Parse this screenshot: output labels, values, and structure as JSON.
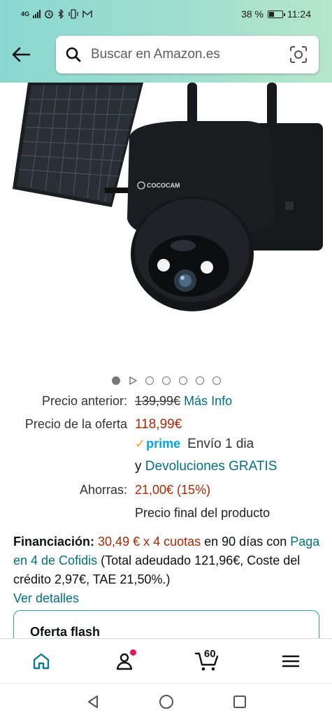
{
  "status_bar": {
    "network": "4G",
    "battery_percent": "38 %",
    "battery_level": 0.38,
    "time": "11:24"
  },
  "header": {
    "search_placeholder": "Buscar en Amazon.es"
  },
  "product": {
    "image_brand_text": "COCOCAM",
    "carousel": {
      "total_images": 7,
      "active_index": 0
    }
  },
  "pricing": {
    "previous_label": "Precio anterior:",
    "previous_price": "139,99€",
    "more_info_link": "Más Info",
    "offer_label": "Precio de la oferta",
    "offer_price": "118,99€",
    "prime_text": "prime",
    "shipping_text": "Envío 1 dia",
    "returns_prefix": "y",
    "returns_link": "Devoluciones GRATIS",
    "savings_label": "Ahorras:",
    "savings_value": "21,00€ (15%)",
    "final_price_note": "Precio final del producto"
  },
  "financing": {
    "label": "Financiación:",
    "installments": "30,49 € x 4 cuotas",
    "text_1": " en 90 días con ",
    "provider_link": "Paga en 4 de Cofidis",
    "text_2": " (Total adeudado 121,96€, Coste del crédito 2,97€, TAE 21,50%.)",
    "details_link": "Ver detalles"
  },
  "flash_offer": {
    "title": "Oferta flash"
  },
  "bottom_nav": {
    "cart_count": "60"
  },
  "colors": {
    "header_gradient_start": "#8ad7d0",
    "header_gradient_end": "#b5e6c9",
    "link": "#007185",
    "price_red": "#b12704",
    "prime_blue": "#00a8e1",
    "notification_dot": "#e3155a"
  }
}
